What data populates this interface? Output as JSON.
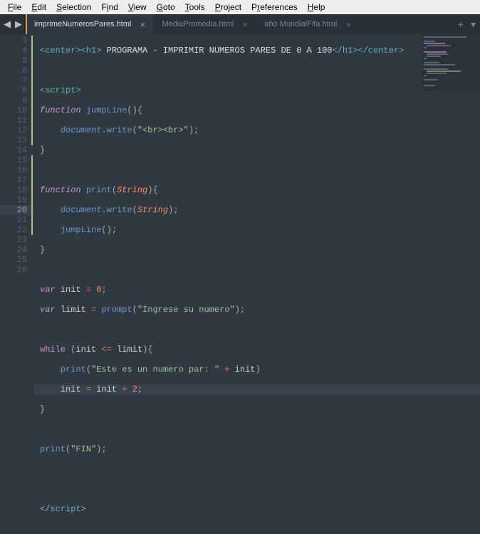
{
  "menu": {
    "file": "File",
    "edit": "Edit",
    "selection": "Selection",
    "find": "Find",
    "view": "View",
    "goto": "Goto",
    "tools": "Tools",
    "project": "Project",
    "preferences": "Preferences",
    "help": "Help"
  },
  "tabs": {
    "t0": "imprimeNumerosPares.html",
    "t1": "MediaPromedia.html",
    "t2": "año MundialFifa.html"
  },
  "gutter": {
    "start": 3,
    "end": 26,
    "highlight": 20
  },
  "code": {
    "l3_txt": "PROGRAMA - IMPRIMIR NUMEROS PARES DE 0 A 100",
    "l3_center_o": "<center>",
    "l3_h1_o": "<h1>",
    "l3_h1_c": "</h1>",
    "l3_center_c": "</center>",
    "l5_scr_o": "<script>",
    "l6_func": "function",
    "l6_name": "jumpLine",
    "l6_par": "(){",
    "l7_obj": "document",
    "l7_dot": ".",
    "l7_fn": "write",
    "l7_po": "(",
    "l7_str": "\"<br><br>\"",
    "l7_pc": ");",
    "l8_cb": "}",
    "l10_func": "function",
    "l10_name": "print",
    "l10_po": "(",
    "l10_param": "String",
    "l10_pc": "){",
    "l11_obj": "document",
    "l11_fn": "write",
    "l11_po": "(",
    "l11_param": "String",
    "l11_pc": ");",
    "l12_fn": "jumpLine",
    "l12_call": "();",
    "l13_cb": "}",
    "l15_var": "var",
    "l15_id": "init",
    "l15_eq": " = ",
    "l15_num": "0",
    "l15_sc": ";",
    "l16_var": "var",
    "l16_id": "limit",
    "l16_eq": " = ",
    "l16_fn": "prompt",
    "l16_po": "(",
    "l16_str": "\"Ingrese su numero\"",
    "l16_pc": ");",
    "l18_while": "while",
    "l18_po": " (",
    "l18_id1": "init",
    "l18_op": " <= ",
    "l18_id2": "limit",
    "l18_pc": "){",
    "l19_fn": "print",
    "l19_po": "(",
    "l19_str": "\"Este es un numero par: \"",
    "l19_op": " + ",
    "l19_id": "init",
    "l19_pc": ")",
    "l20_id1": "init",
    "l20_eq": " = ",
    "l20_id2": "init",
    "l20_op": " + ",
    "l20_num": "2",
    "l20_sc": ";",
    "l21_cb": "}",
    "l23_fn": "print",
    "l23_po": "(",
    "l23_str": "\"FIN\"",
    "l23_pc": ");",
    "l26_scr_c": "script",
    "l26_lt": "</",
    "l26_gt": ">"
  }
}
